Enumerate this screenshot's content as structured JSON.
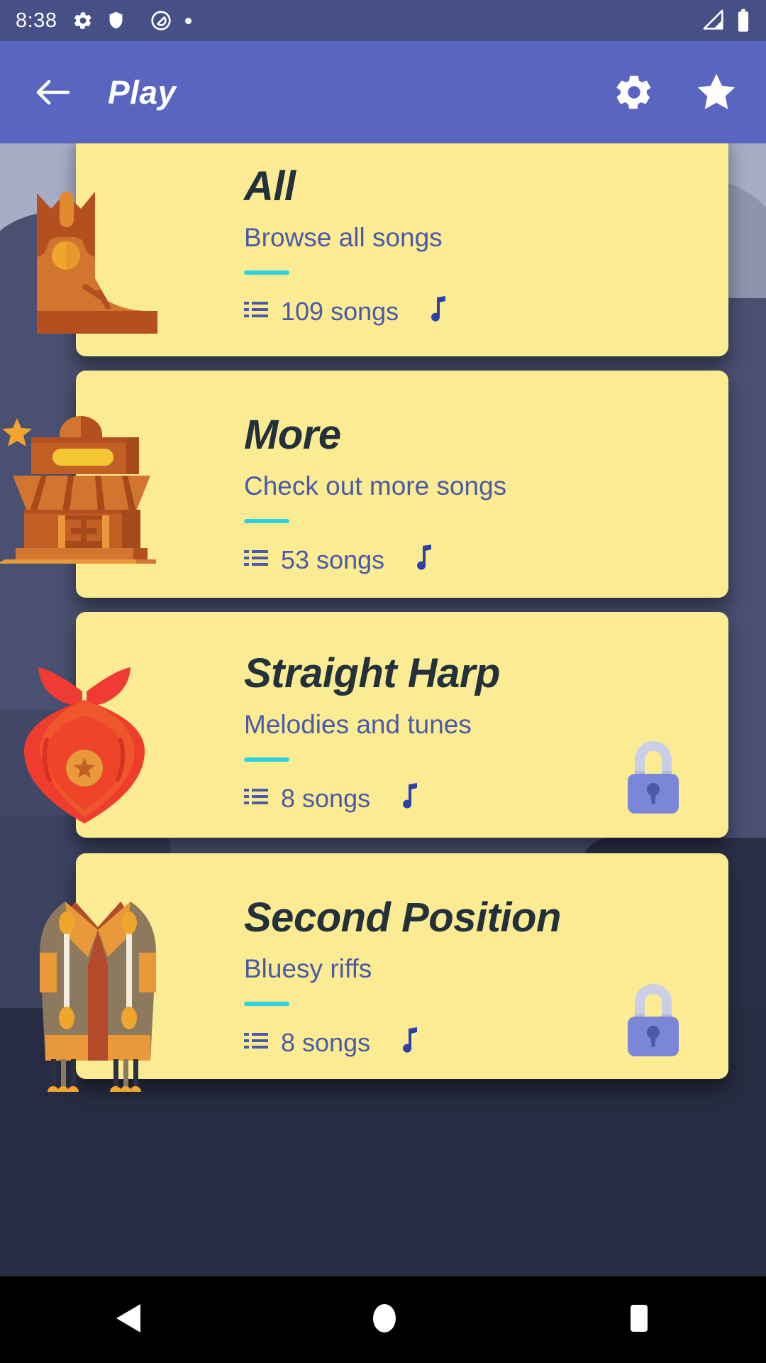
{
  "status_bar": {
    "time": "8:38",
    "icons": [
      "gear-icon",
      "shield-icon",
      "do-not-disturb-icon",
      "dot-icon"
    ],
    "right_icons": [
      "cellular-signal-icon",
      "battery-icon"
    ]
  },
  "app_bar": {
    "back_label": "back-arrow",
    "title": "Play",
    "actions": [
      {
        "name": "settings",
        "icon": "gear-icon"
      },
      {
        "name": "favorites",
        "icon": "star-icon"
      }
    ]
  },
  "cards": [
    {
      "title": "All",
      "subtitle": "Browse all songs",
      "count_label": "109 songs",
      "locked": false,
      "art": "cowboy-boot"
    },
    {
      "title": "More",
      "subtitle": "Check out more songs",
      "count_label": "53 songs",
      "locked": false,
      "art": "saloon-building"
    },
    {
      "title": "Straight Harp",
      "subtitle": "Melodies and tunes",
      "count_label": "8 songs",
      "locked": true,
      "art": "bandana"
    },
    {
      "title": "Second Position",
      "subtitle": "Bluesy riffs",
      "count_label": "8 songs",
      "locked": true,
      "art": "vest"
    }
  ],
  "nav_bar": {
    "back": "back-triangle",
    "home": "home-circle",
    "recents": "recents-square"
  },
  "colors": {
    "status_bar": "#464f86",
    "app_bar": "#5a65c0",
    "card": "#fbeb93",
    "accent_rule": "#2ed1e0",
    "subtitle": "#4a5aa8",
    "title": "#22313b",
    "lock_body": "#7b86d8",
    "lock_shackle": "#c8cfe6",
    "background": "#4a5071"
  }
}
